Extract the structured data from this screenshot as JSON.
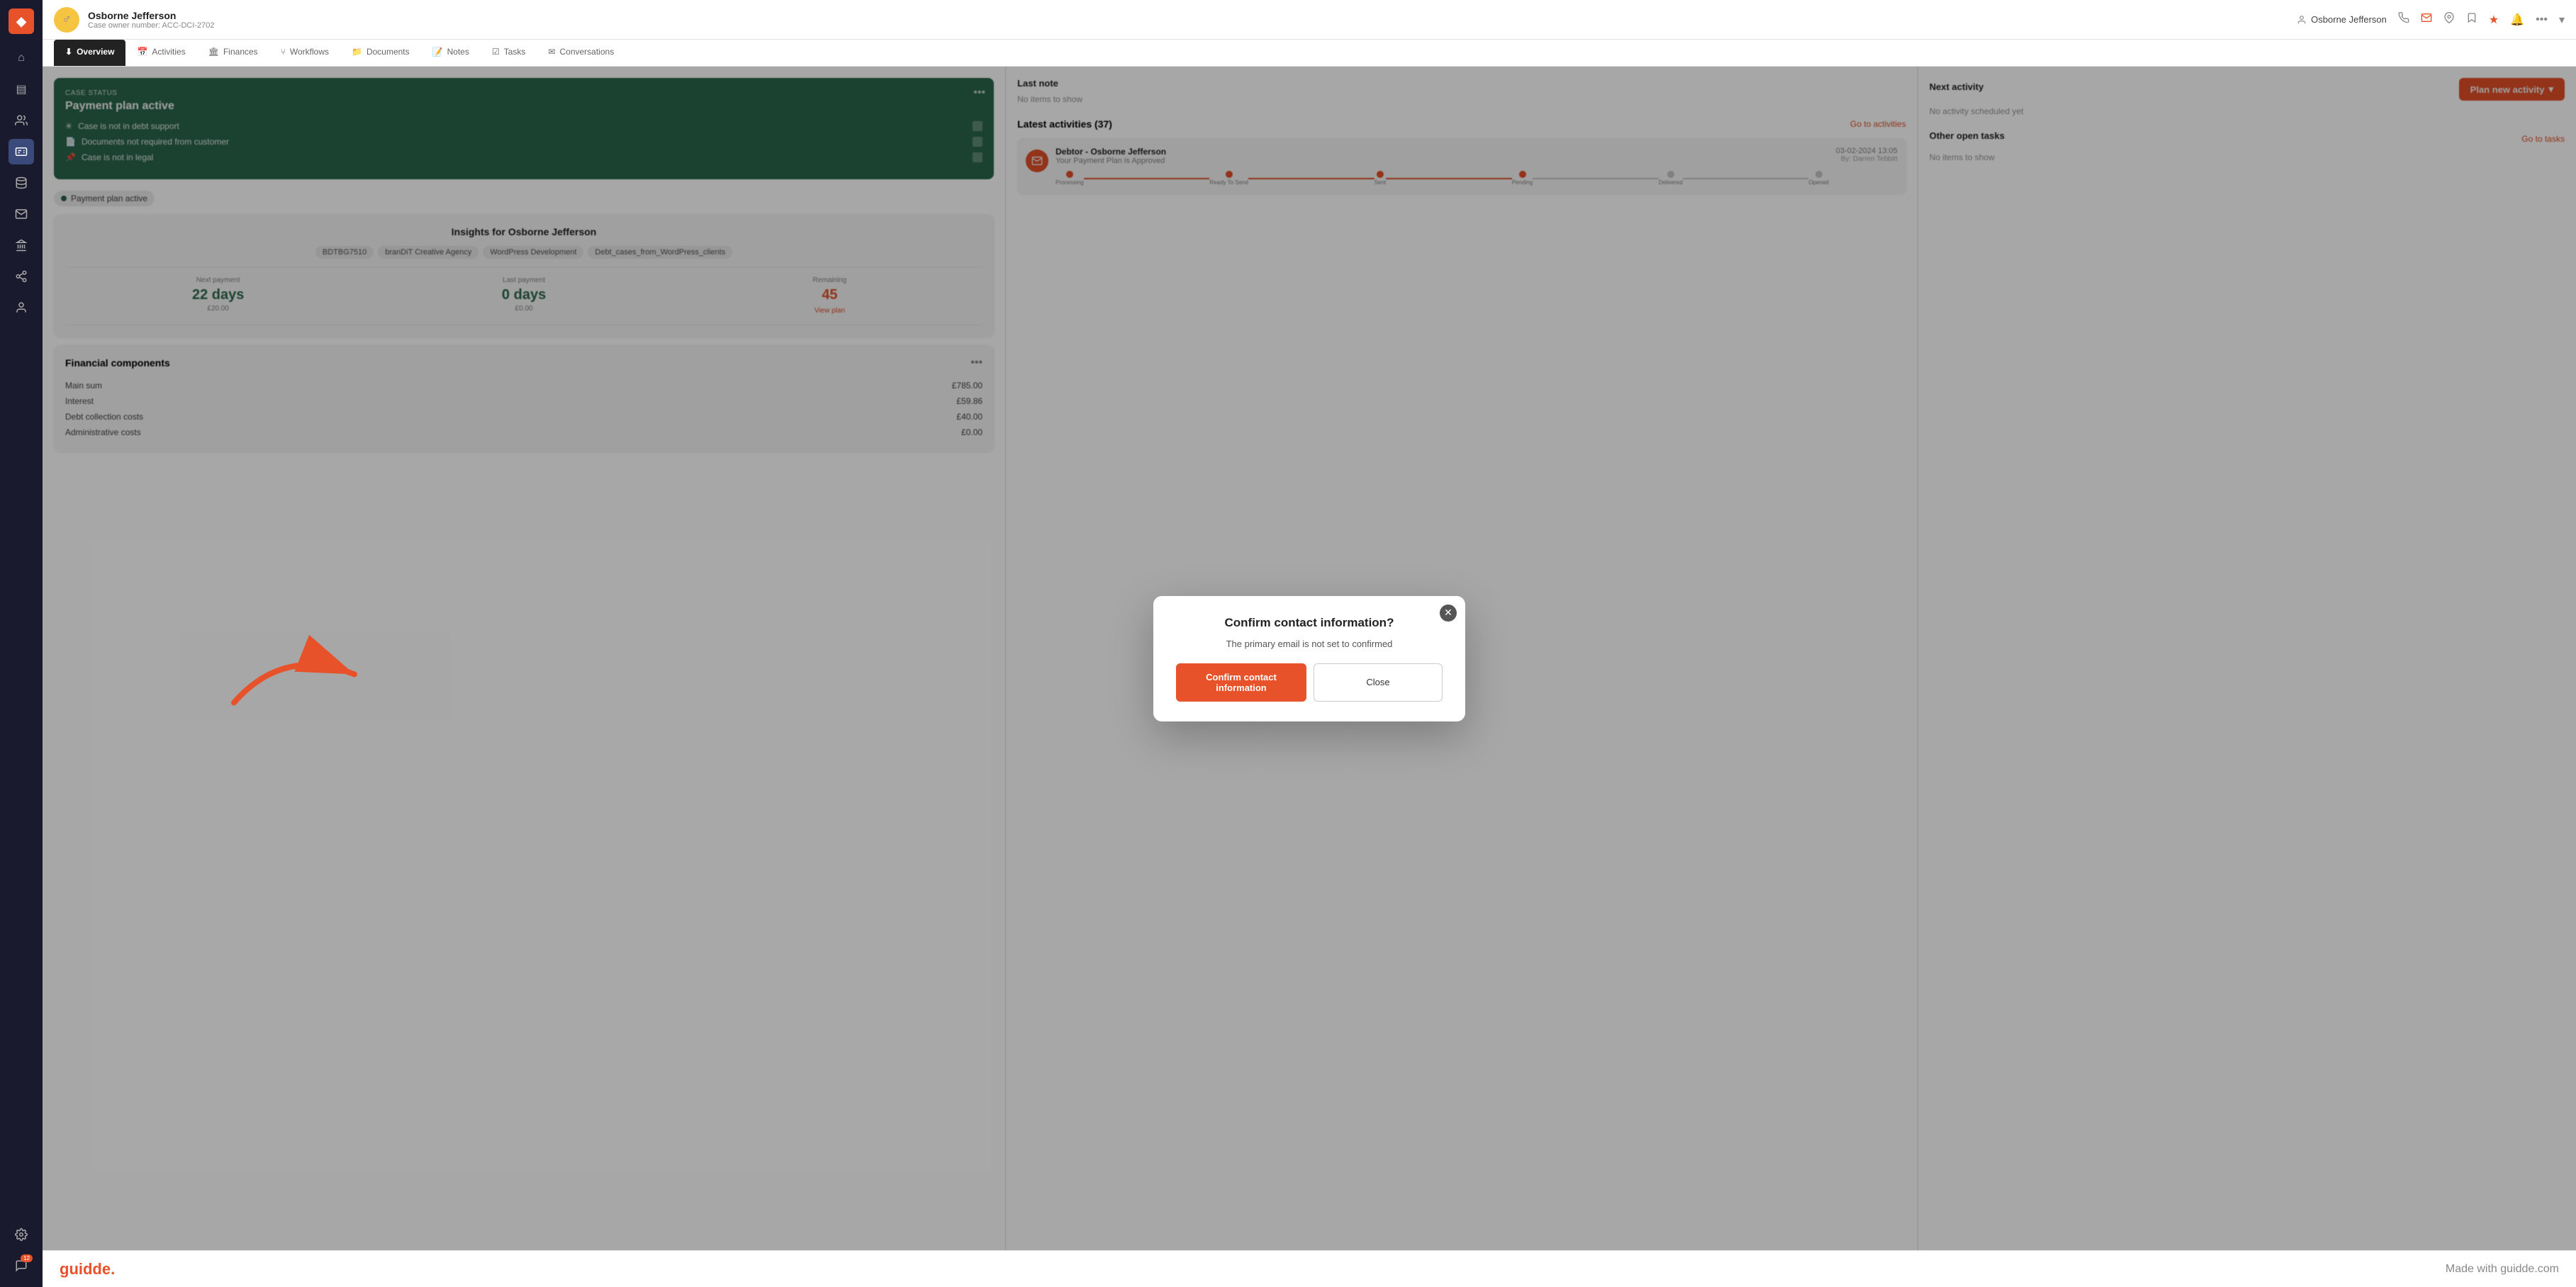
{
  "sidebar": {
    "logo": "◆",
    "items": [
      {
        "name": "home-icon",
        "icon": "⌂",
        "active": false
      },
      {
        "name": "cases-icon",
        "icon": "▤",
        "active": false
      },
      {
        "name": "contacts-icon",
        "icon": "👥",
        "active": false
      },
      {
        "name": "id-card-icon",
        "icon": "🪪",
        "active": true
      },
      {
        "name": "database-icon",
        "icon": "🗄",
        "active": false
      },
      {
        "name": "mail-icon",
        "icon": "✉",
        "active": false
      },
      {
        "name": "bank-icon",
        "icon": "🏛",
        "active": false
      },
      {
        "name": "workflow-icon",
        "icon": "⑂",
        "active": false
      },
      {
        "name": "team-icon",
        "icon": "👤",
        "active": false
      },
      {
        "name": "settings-icon",
        "icon": "⚙",
        "active": false
      }
    ],
    "badge_count": "12"
  },
  "header": {
    "case_name": "Osborne Jefferson",
    "case_number": "Case owner number: ACC-DCI-2702",
    "user_name": "Osborne Jefferson",
    "edit_icon": "✎"
  },
  "nav_tabs": [
    {
      "label": "Overview",
      "icon": "⬇",
      "active": true
    },
    {
      "label": "Activities",
      "icon": "📅",
      "active": false
    },
    {
      "label": "Finances",
      "icon": "🏛",
      "active": false
    },
    {
      "label": "Workflows",
      "icon": "⑂",
      "active": false
    },
    {
      "label": "Documents",
      "icon": "📁",
      "active": false
    },
    {
      "label": "Notes",
      "icon": "📝",
      "active": false
    },
    {
      "label": "Tasks",
      "icon": "☑",
      "active": false
    },
    {
      "label": "Conversations",
      "icon": "✉",
      "active": false
    }
  ],
  "left_col": {
    "green_card": {
      "label": "CASE STATUS",
      "heading": "Payment plan active",
      "items": [
        {
          "icon": "✳",
          "text": "Case is not in debt support"
        },
        {
          "icon": "📄",
          "text": "Documents not required from customer"
        },
        {
          "icon": "📌",
          "text": "Case is not in legal"
        }
      ]
    },
    "info_badge": "Payment plan active",
    "insights": {
      "title": "Insights for Osborne Jefferson",
      "tags": [
        "BDTBG7510",
        "branDiT Creative Agency",
        "WordPress Development",
        "Debt_cases_from_WordPress_clients"
      ]
    },
    "payment_stats": {
      "next_payment": {
        "label": "Next payment",
        "value": "22 days",
        "sub": "£20.00"
      },
      "last_payment": {
        "label": "Last payment",
        "value": "0 days",
        "sub": "£0.00"
      },
      "remaining": {
        "label": "Remaining",
        "value": "45",
        "link": "View plan"
      }
    },
    "financial_components": {
      "title": "Financial components",
      "rows": [
        {
          "label": "Main sum",
          "value": "£785.00"
        },
        {
          "label": "Interest",
          "value": "£59.86"
        },
        {
          "label": "Debt collection costs",
          "value": "£40.00"
        },
        {
          "label": "Administrative costs",
          "value": "£0.00"
        }
      ]
    }
  },
  "mid_col": {
    "last_note": {
      "title": "Last note",
      "empty": "No items to show"
    },
    "latest_activities": {
      "title": "Latest activities (37)",
      "go_link": "Go to activities",
      "items": [
        {
          "sender": "Debtor - Osborne Jefferson",
          "sub": "Your Payment Plan is Approved",
          "date": "03-02-2024 13:05",
          "by": "By: Darren Tebbitt",
          "steps": [
            "Processing",
            "Ready To Send",
            "Sent",
            "Pending",
            "Delivered",
            "Opened"
          ],
          "active_step": 3
        }
      ]
    }
  },
  "right_col": {
    "next_activity": {
      "title": "Next activity",
      "btn": "Plan new activity",
      "empty": "No activity scheduled yet"
    },
    "open_tasks": {
      "title": "Other open tasks",
      "go_link": "Go to tasks",
      "empty": "No items to show"
    }
  },
  "modal": {
    "title": "Confirm contact information?",
    "body": "The primary email is not set to confirmed",
    "confirm_btn": "Confirm contact information",
    "close_btn": "Close"
  },
  "footer": {
    "logo": "guidde.",
    "tagline": "Made with guidde.com"
  }
}
